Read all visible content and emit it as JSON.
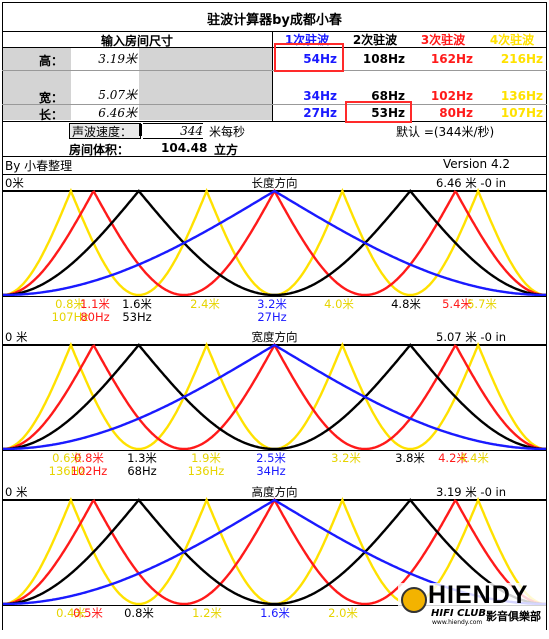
{
  "title": "驻波计算器by成都小春",
  "room_header": "输入房间尺寸",
  "mode_headers": [
    "1次驻波",
    "2次驻波",
    "3次驻波",
    "4次驻波"
  ],
  "mode_colors": [
    "#1a1aff",
    "#000000",
    "#ff1a1a",
    "#ffe100"
  ],
  "rows": {
    "height": {
      "label": "高：",
      "value": "3.19米",
      "freqs": [
        "54Hz",
        "108Hz",
        "162Hz",
        "216Hz"
      ]
    },
    "width": {
      "label": "宽：",
      "value": "5.07米",
      "freqs": [
        "34Hz",
        "68Hz",
        "102Hz",
        "136Hz"
      ]
    },
    "length": {
      "label": "长：",
      "value": "6.46米",
      "freqs": [
        "27Hz",
        "53Hz",
        "80Hz",
        "107Hz"
      ]
    }
  },
  "sound_speed": {
    "label": "声波速度：",
    "value": "344",
    "unit": "米每秒",
    "default": "默认 =(344米/秒)"
  },
  "volume": {
    "label": "房间体积：",
    "value": "104.48",
    "unit": "立方"
  },
  "credit": "By 小春整理",
  "version": "Version 4.2",
  "panels": [
    {
      "name": "length",
      "title": "长度方向",
      "left": "0米",
      "right": "6.46 米 -0 in",
      "labels": [
        {
          "dist": "0.8米",
          "freq": "107Hz",
          "color": "#e6d400"
        },
        {
          "dist": "1.1米",
          "freq": "80Hz",
          "color": "#ff1a1a"
        },
        {
          "dist": "1.6米",
          "freq": "53Hz",
          "color": "#000000"
        },
        {
          "dist": "2.4米",
          "freq": "",
          "color": "#e6d400"
        },
        {
          "dist": "3.2米",
          "freq": "27Hz",
          "color": "#1a1aff"
        },
        {
          "dist": "4.0米",
          "freq": "",
          "color": "#e6d400"
        },
        {
          "dist": "4.8米",
          "freq": "",
          "color": "#000000"
        },
        {
          "dist": "5.4米",
          "freq": "",
          "color": "#ff1a1a"
        },
        {
          "dist": "5.7米",
          "freq": "",
          "color": "#e6d400"
        }
      ]
    },
    {
      "name": "width",
      "title": "宽度方向",
      "left": "0 米",
      "right": "5.07 米 -0 in",
      "labels": [
        {
          "dist": "0.6米",
          "freq": "136Hz",
          "color": "#e6d400"
        },
        {
          "dist": "0.8米",
          "freq": "102Hz",
          "color": "#ff1a1a"
        },
        {
          "dist": "1.3米",
          "freq": "68Hz",
          "color": "#000000"
        },
        {
          "dist": "1.9米",
          "freq": "136Hz",
          "color": "#e6d400"
        },
        {
          "dist": "2.5米",
          "freq": "34Hz",
          "color": "#1a1aff"
        },
        {
          "dist": "3.2米",
          "freq": "",
          "color": "#e6d400"
        },
        {
          "dist": "3.8米",
          "freq": "",
          "color": "#000000"
        },
        {
          "dist": "4.2米",
          "freq": "",
          "color": "#ff1a1a"
        },
        {
          "dist": "4.4米",
          "freq": "",
          "color": "#e6d400"
        }
      ]
    },
    {
      "name": "height",
      "title": "高度方向",
      "left": "0 米",
      "right": "3.19 米 -0 in",
      "labels": [
        {
          "dist": "0.4米",
          "freq": "",
          "color": "#e6d400"
        },
        {
          "dist": "0.5米",
          "freq": "",
          "color": "#ff1a1a"
        },
        {
          "dist": "0.8米",
          "freq": "",
          "color": "#000000"
        },
        {
          "dist": "1.2米",
          "freq": "",
          "color": "#e6d400"
        },
        {
          "dist": "1.6米",
          "freq": "",
          "color": "#1a1aff"
        },
        {
          "dist": "2.0米",
          "freq": "",
          "color": "#e6d400"
        }
      ]
    }
  ],
  "watermark": {
    "brand": "HIENDY",
    "sub": "HIFI CLUB",
    "cn": "影音俱樂部",
    "url": "www.hiendy.com"
  }
}
